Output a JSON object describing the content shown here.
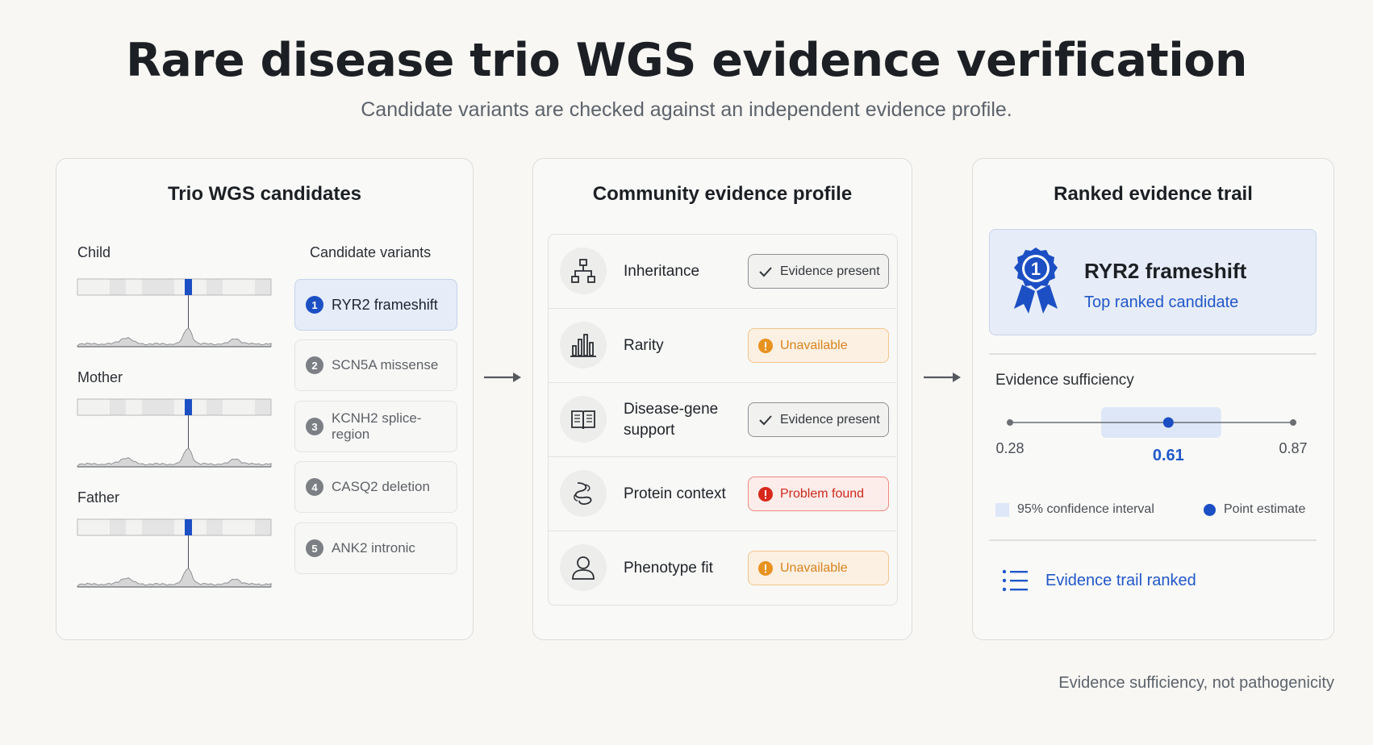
{
  "header": {
    "title": "Rare disease trio WGS evidence verification",
    "subtitle": "Candidate variants are checked against an independent evidence profile."
  },
  "panel_candidates": {
    "title": "Trio WGS candidates",
    "tracks": [
      {
        "label": "Child"
      },
      {
        "label": "Mother"
      },
      {
        "label": "Father"
      }
    ],
    "candidates_header": "Candidate variants",
    "candidates": [
      {
        "num": "1",
        "label": "RYR2 frameshift",
        "selected": true
      },
      {
        "num": "2",
        "label": "SCN5A missense",
        "selected": false
      },
      {
        "num": "3",
        "label": "KCNH2 splice-region",
        "selected": false
      },
      {
        "num": "4",
        "label": "CASQ2 deletion",
        "selected": false
      },
      {
        "num": "5",
        "label": "ANK2 intronic",
        "selected": false
      }
    ]
  },
  "panel_profile": {
    "title": "Community evidence profile",
    "rows": [
      {
        "label": "Inheritance",
        "icon": "hierarchy-icon",
        "status": "Evidence present",
        "state": "ok"
      },
      {
        "label": "Rarity",
        "icon": "bar-chart-icon",
        "status": "Unavailable",
        "state": "warn"
      },
      {
        "label": "Disease-gene support",
        "icon": "open-book-icon",
        "status": "Evidence present",
        "state": "ok"
      },
      {
        "label": "Protein context",
        "icon": "protein-structure-icon",
        "status": "Problem found",
        "state": "bad"
      },
      {
        "label": "Phenotype fit",
        "icon": "person-icon",
        "status": "Unavailable",
        "state": "warn"
      }
    ]
  },
  "panel_trail": {
    "title": "Ranked evidence trail",
    "rank_badge": "1",
    "top_name": "RYR2 frameshift",
    "top_sub": "Top ranked candidate",
    "sufficiency_title": "Evidence sufficiency",
    "sufficiency": {
      "min": 0.28,
      "max": 0.87,
      "ci_low": 0.47,
      "ci_high": 0.72,
      "point": 0.61
    },
    "min_label": "0.28",
    "point_label": "0.61",
    "max_label": "0.87",
    "legend_ci": "95% confidence interval",
    "legend_point": "Point estimate",
    "trail_link": "Evidence trail ranked"
  },
  "footnote": "Evidence sufficiency, not pathogenicity",
  "colors": {
    "accent": "#1c4fc4",
    "ok": "#33373b",
    "warn": "#d7831f",
    "bad": "#cc2a1d",
    "ci_band": "#dde7f7"
  }
}
